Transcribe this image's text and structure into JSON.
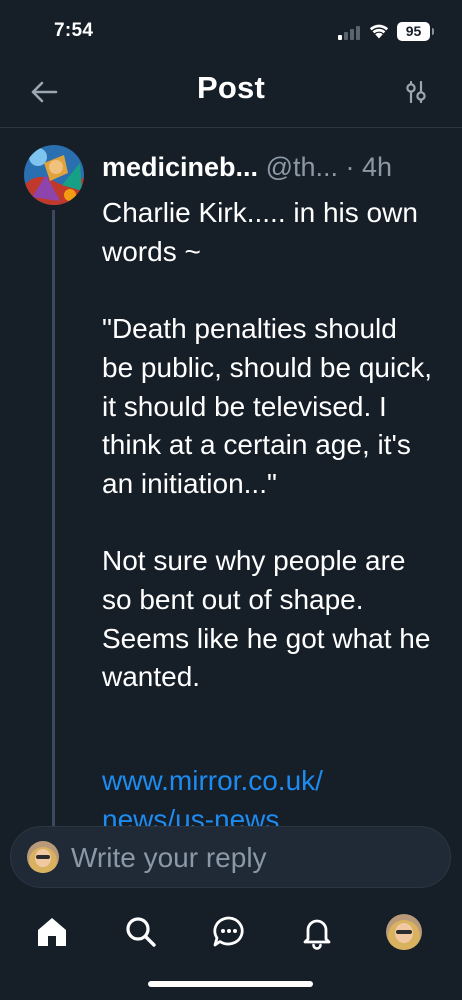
{
  "status_bar": {
    "time": "7:54",
    "battery": "95"
  },
  "header": {
    "title": "Post",
    "back_icon": "arrow-left-icon",
    "settings_icon": "sliders-icon"
  },
  "post": {
    "author_name": "medicineb...",
    "author_handle": "@th...",
    "separator": "·",
    "time": "4h",
    "body": "Charlie Kirk..... in his own words ~\n\n\"Death penalties should be public, should be quick, it should be televised. I think at a certain age, it's an initiation...\"\n\nNot sure why people are so bent out of shape.  Seems like he got what he wanted.",
    "link": "www.mirror.co.uk/\nnews/us-news"
  },
  "reply": {
    "placeholder": "Write your reply"
  },
  "bottom_nav": {
    "items": [
      "home-icon",
      "search-icon",
      "chat-icon",
      "bell-icon",
      "profile-avatar"
    ]
  },
  "colors": {
    "background": "#161e27",
    "divider": "#2b3640",
    "link": "#1d8bf0",
    "muted": "#8b98a5"
  }
}
